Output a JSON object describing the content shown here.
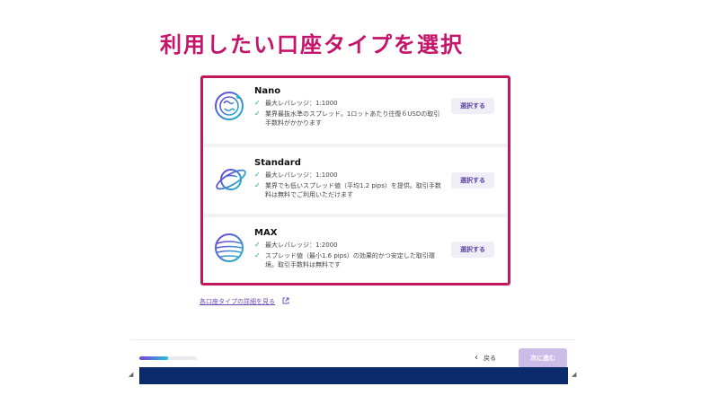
{
  "headline": "利用したい口座タイプを選択",
  "accounts": [
    {
      "name": "Nano",
      "icon": "nano-planet-icon",
      "features": [
        "最大レバレッジ：1:1000",
        "業界最抜水準のスプレッド。1ロットあたり往復６USDの取引手数料がかかります"
      ],
      "button": "選択する"
    },
    {
      "name": "Standard",
      "icon": "saturn-planet-icon",
      "features": [
        "最大レバレッジ：1:1000",
        "業界でも低いスプレッド値（平均1.2 pips）を提供。取引手数料は無料でご利用いただけます"
      ],
      "button": "選択する"
    },
    {
      "name": "MAX",
      "icon": "striped-planet-icon",
      "features": [
        "最大レバレッジ：1:2000",
        "スプレッド値（最小1.6 pips）の効果的かつ安定した取引環境。取引手数料は無料です"
      ],
      "button": "選択する"
    }
  ],
  "details_link": "各口座タイプの詳細を見る",
  "footer": {
    "progress": 0.5,
    "back_label": "戻る",
    "next_label": "次に進む"
  },
  "colors": {
    "headline": "#c4146b",
    "highlight_frame": "#c2185b",
    "check": "#1aa57a",
    "button_text": "#5a3fa0",
    "next_disabled": "#cdbbe8",
    "bottom_bar": "#0a2a6b"
  }
}
